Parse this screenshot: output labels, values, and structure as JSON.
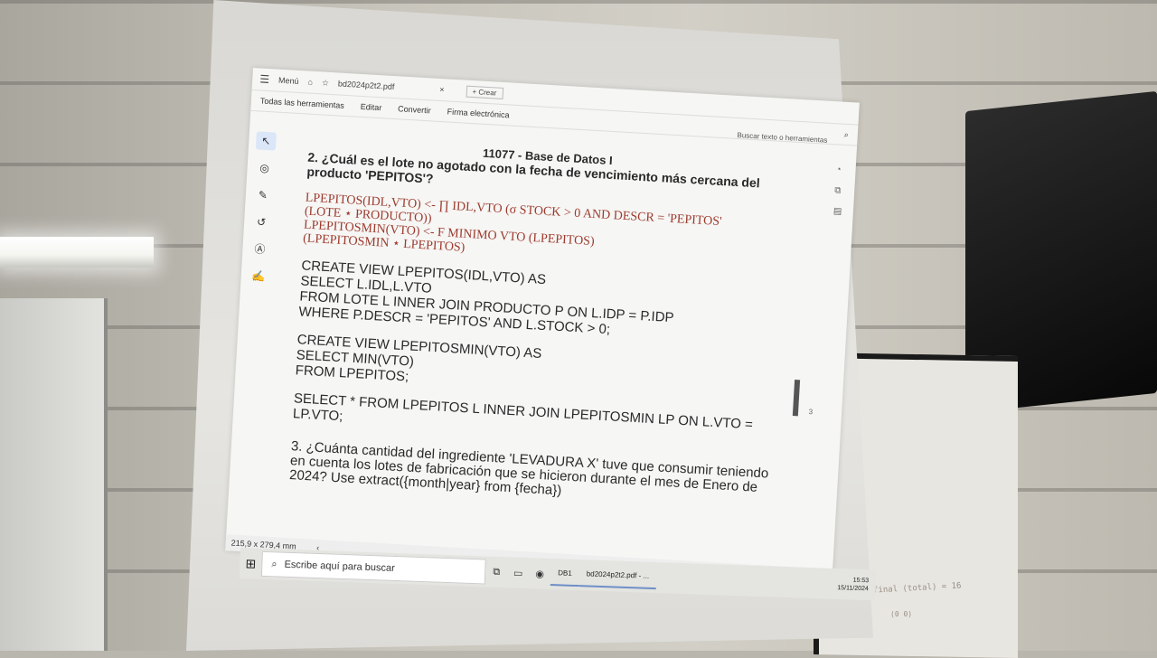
{
  "window": {
    "menu_label": "Menú",
    "tab_title": "bd2024p2t2.pdf",
    "new_tab": "+ Crear"
  },
  "menubar": {
    "items": [
      "Todas las herramientas",
      "Editar",
      "Convertir",
      "Firma electrónica"
    ],
    "search": "Buscar texto o herramientas"
  },
  "document": {
    "header": "11077 - Base de Datos I",
    "q2": "2. ¿Cuál es el lote no agotado con la fecha de vencimiento más cercana del producto 'PEPITOS'?",
    "algebra": [
      "LPEPITOS(IDL,VTO) <- ∏ IDL,VTO (σ STOCK > 0 AND DESCR = 'PEPITOS'",
      "(LOTE ⋆ PRODUCTO))",
      "LPEPITOSMIN(VTO) <- F MINIMO VTO (LPEPITOS)",
      "(LPEPITOSMIN ⋆ LPEPITOS)"
    ],
    "sql1": "CREATE VIEW LPEPITOS(IDL,VTO) AS\nSELECT L.IDL,L.VTO\nFROM LOTE L INNER JOIN PRODUCTO P ON L.IDP = P.IDP\nWHERE P.DESCR = 'PEPITOS' AND L.STOCK > 0;",
    "sql2": "CREATE VIEW LPEPITOSMIN(VTO) AS\nSELECT MIN(VTO)\nFROM LPEPITOS;",
    "sql3": "SELECT * FROM LPEPITOS L INNER JOIN LPEPITOSMIN LP ON L.VTO =\nLP.VTO;",
    "q3": "3. ¿Cuánta cantidad del ingrediente 'LEVADURA X' tuve que consumir teniendo en cuenta los lotes de fabricación que se hicieron durante el mes de Enero de 2024? Use extract({month|year} from {fecha})"
  },
  "status": {
    "page_size": "215,9 x 279,4 mm",
    "page_number": "3"
  },
  "taskbar": {
    "search_placeholder": "Escribe aquí para buscar",
    "app1": "DB1",
    "app2": "bd2024p2t2.pdf - ...",
    "time": "15:53",
    "date": "15/11/2024"
  },
  "board_note": "final (total) = 16",
  "board_note2": "(0 0)"
}
